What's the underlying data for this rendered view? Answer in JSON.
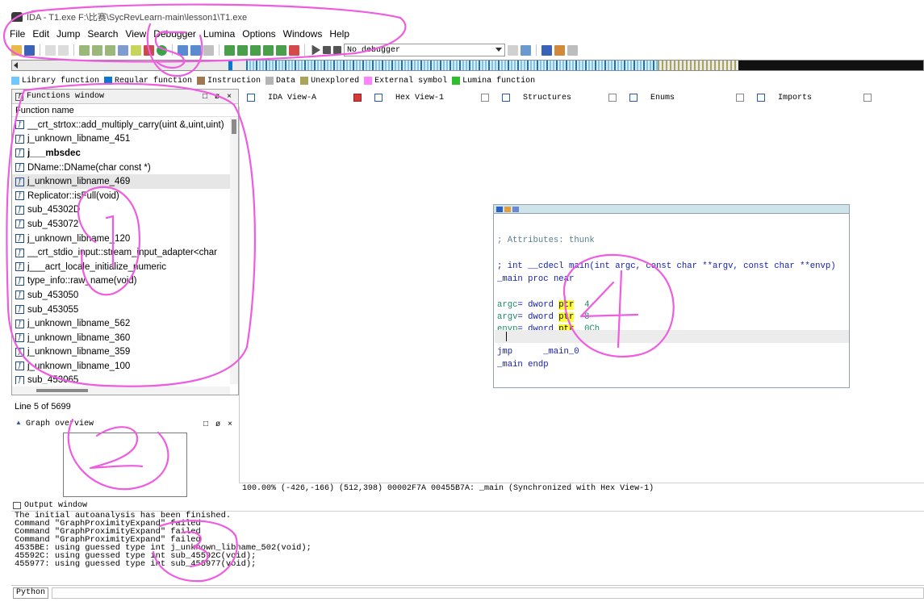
{
  "window": {
    "title": "IDA - T1.exe F:\\比赛\\SycRevLearn-main\\lesson1\\T1.exe"
  },
  "menu": [
    "File",
    "Edit",
    "Jump",
    "Search",
    "View",
    "Debugger",
    "Lumina",
    "Options",
    "Windows",
    "Help"
  ],
  "toolbar": {
    "debugger_select": "No debugger"
  },
  "legend": [
    {
      "label": "Library function",
      "color": "#6ec8ff"
    },
    {
      "label": "Regular function",
      "color": "#0a78d2"
    },
    {
      "label": "Instruction",
      "color": "#a07850"
    },
    {
      "label": "Data",
      "color": "#b4b4b4"
    },
    {
      "label": "Unexplored",
      "color": "#aaa35a"
    },
    {
      "label": "External symbol",
      "color": "#ff82ff"
    },
    {
      "label": "Lumina function",
      "color": "#2dbe2d"
    }
  ],
  "functions_window": {
    "title": "Functions window",
    "column_header": "Function name",
    "items": [
      {
        "name": "__crt_strtox::add_multiply_carry(uint &,uint,uint)",
        "bold": false,
        "selected": false
      },
      {
        "name": "j_unknown_libname_451",
        "bold": false,
        "selected": false
      },
      {
        "name": "j___mbsdec",
        "bold": true,
        "selected": false
      },
      {
        "name": "DName::DName(char const *)",
        "bold": false,
        "selected": false
      },
      {
        "name": "j_unknown_libname_469",
        "bold": false,
        "selected": true
      },
      {
        "name": "Replicator::isFull(void)",
        "bold": false,
        "selected": false
      },
      {
        "name": "sub_45302D",
        "bold": false,
        "selected": false
      },
      {
        "name": "sub_453072",
        "bold": false,
        "selected": false
      },
      {
        "name": "j_unknown_libname_120",
        "bold": false,
        "selected": false
      },
      {
        "name": "__crt_stdio_input::stream_input_adapter<char",
        "bold": false,
        "selected": false
      },
      {
        "name": "j___acrt_locale_initialize_numeric",
        "bold": false,
        "selected": false
      },
      {
        "name": "type_info::raw_name(void)",
        "bold": false,
        "selected": false
      },
      {
        "name": "sub_453050",
        "bold": false,
        "selected": false
      },
      {
        "name": "sub_453055",
        "bold": false,
        "selected": false
      },
      {
        "name": "j_unknown_libname_562",
        "bold": false,
        "selected": false
      },
      {
        "name": "j_unknown_libname_360",
        "bold": false,
        "selected": false
      },
      {
        "name": "j_unknown_libname_359",
        "bold": false,
        "selected": false
      },
      {
        "name": "j_unknown_libname_100",
        "bold": false,
        "selected": false
      },
      {
        "name": "sub_453065",
        "bold": false,
        "selected": false
      }
    ],
    "status": "Line 5 of 5699"
  },
  "graph_overview": {
    "title": "Graph overview"
  },
  "tabs": [
    {
      "label": "IDA View-A",
      "active": true
    },
    {
      "label": "Hex View-1",
      "active": false
    },
    {
      "label": "Structures",
      "active": false
    },
    {
      "label": "Enums",
      "active": false
    },
    {
      "label": "Imports",
      "active": false
    }
  ],
  "disassembly": {
    "attributes_comment": "; Attributes: thunk",
    "signature_comment": "; int __cdecl main(int argc, const char **argv, const char **envp)",
    "proc_name": "_main",
    "proc_kw": " proc near",
    "args": [
      {
        "name": "argc",
        "kw": "= dword ",
        "ptr": "ptr",
        "val": "4"
      },
      {
        "name": "argv",
        "kw": "= dword ",
        "ptr": "ptr",
        "val": "8"
      },
      {
        "name": "envp",
        "kw": "= dword ",
        "ptr": "ptr",
        "val": "0Ch"
      }
    ],
    "jmp_op": "jmp",
    "jmp_target": "_main_0",
    "endp_name": "_main",
    "endp_kw": " endp"
  },
  "graph_status": "100.00% (-426,-166) (512,398) 00002F7A 00455B7A: _main (Synchronized with Hex View-1)",
  "output_window": {
    "title": "Output window",
    "lines": [
      "The initial autoanalysis has been finished.",
      "Command \"GraphProximityExpand\" failed",
      "Command \"GraphProximityExpand\" failed",
      "Command \"GraphProximityExpand\" failed",
      "4535BE: using guessed type int j_unknown_libname_502(void);",
      "45592C: using guessed type int sub_45592C(void);",
      "455977: using guessed type int sub_455977(void);"
    ]
  },
  "input_bar": {
    "language": "Python"
  },
  "annotations": [
    "1",
    "2",
    "3",
    "4",
    "5"
  ],
  "ui_colors": {
    "annotation_pink": "#ee5ce0",
    "selection": "#e6e6e6",
    "node_title": "#cfe3ea",
    "ptr_highlight": "#ffff33"
  }
}
